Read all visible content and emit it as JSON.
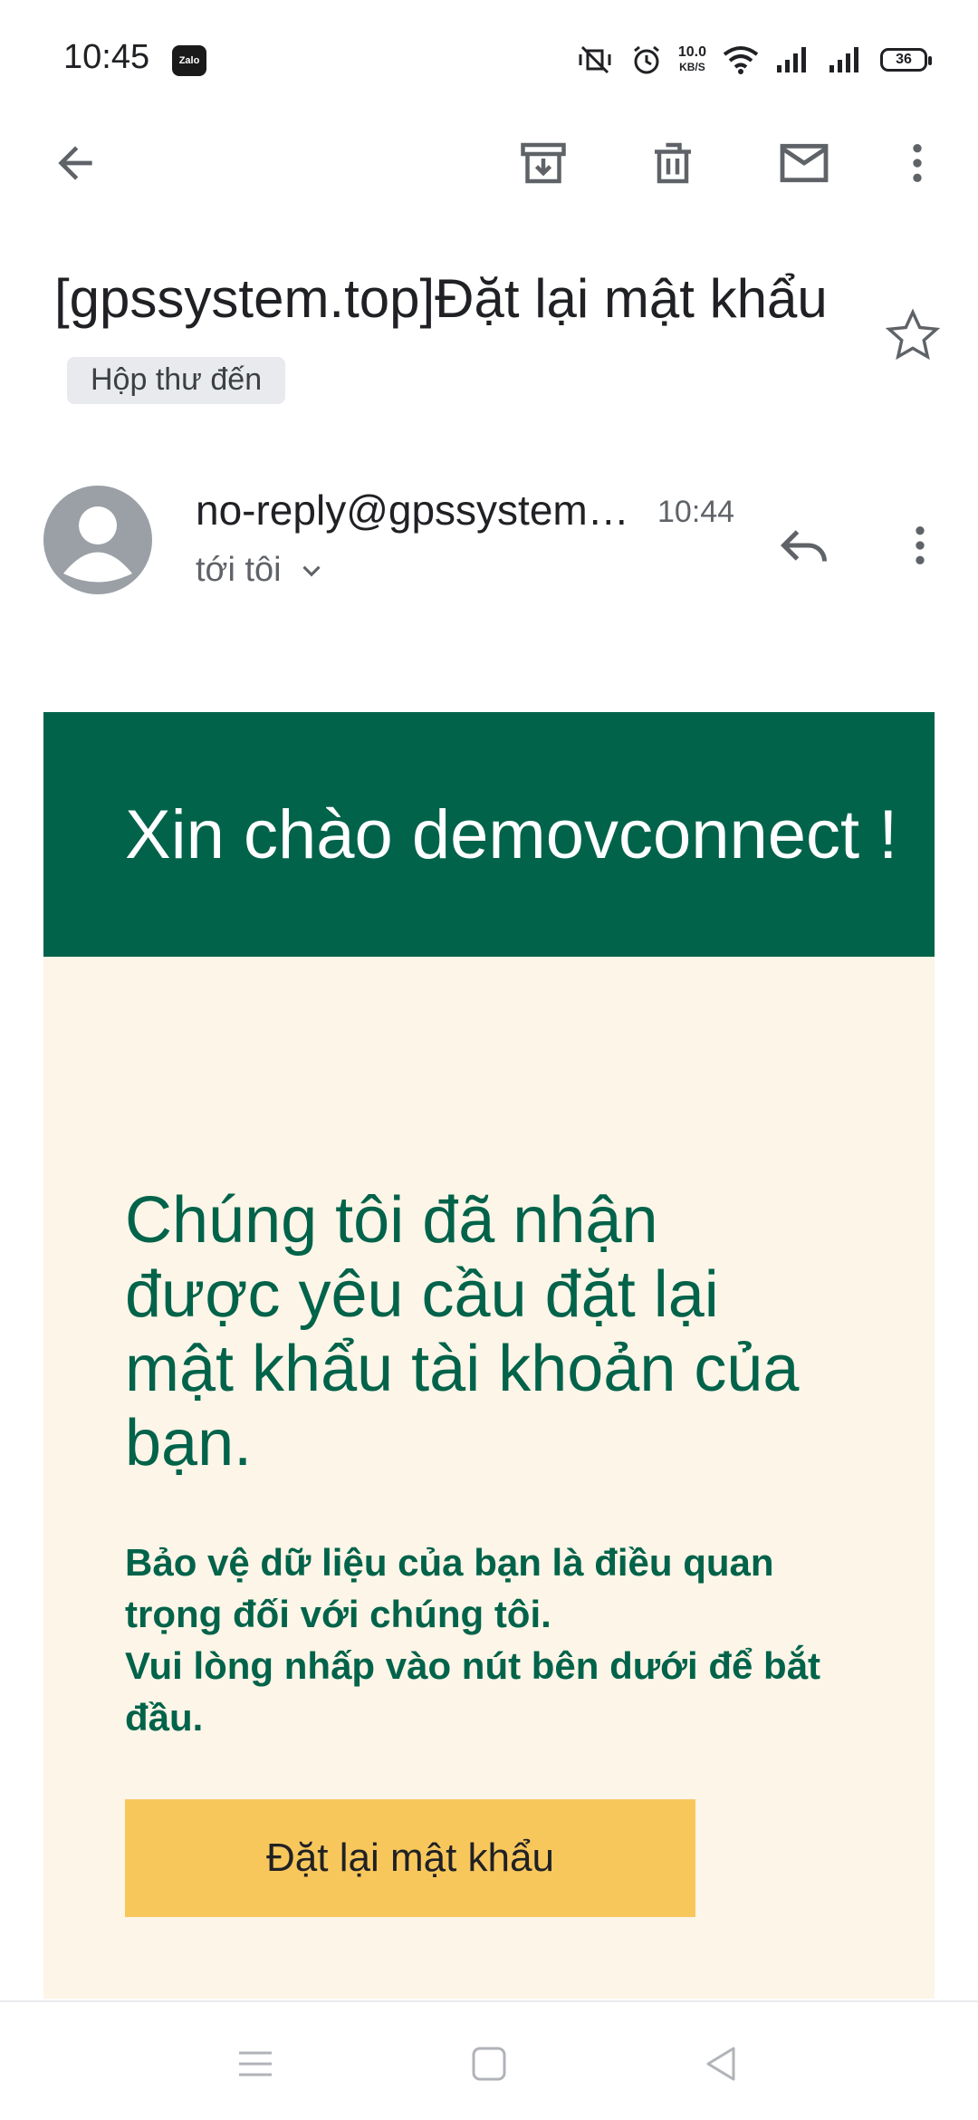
{
  "status_bar": {
    "time": "10:45",
    "app_icon": "Zalo",
    "net_speed_value": "10.0",
    "net_speed_unit": "KB/S",
    "battery": "36"
  },
  "toolbar": {
    "back": "arrow-left-icon",
    "archive": "archive-icon",
    "delete": "trash-icon",
    "mark_unread": "mail-icon",
    "more": "more-vert-icon"
  },
  "email": {
    "subject": "[gpssystem.top]Đặt lại mật khẩu",
    "label": "Hộp thư đến",
    "sender": "no-reply@gpssystem.top",
    "time": "10:44",
    "recipient": "tới tôi"
  },
  "body": {
    "greeting": "Xin chào demovconnect !",
    "heading": "Chúng tôi đã nhận được yêu cầu đặt lại mật khẩu tài khoản của bạn.",
    "text_line1": "Bảo vệ dữ liệu của bạn là điều quan trọng đối với chúng tôi.",
    "text_line2": "Vui lòng nhấp vào nút bên dưới để bắt đầu.",
    "button_label": "Đặt lại mật khẩu"
  },
  "colors": {
    "brand_green": "#00634a",
    "card_bg": "#fdf5e7",
    "button_yellow": "#f8c75c"
  }
}
